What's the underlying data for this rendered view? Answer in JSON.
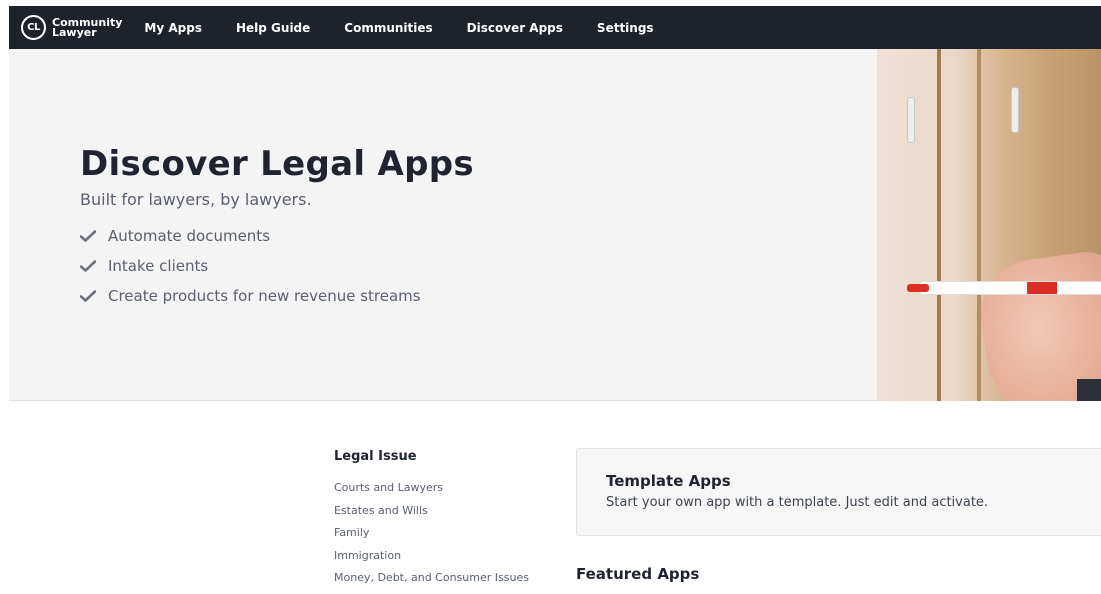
{
  "nav": {
    "logo": {
      "mark": "CL",
      "line1": "Community",
      "line2": "Lawyer"
    },
    "items": [
      "My Apps",
      "Help Guide",
      "Communities",
      "Discover Apps",
      "Settings"
    ]
  },
  "hero": {
    "title": "Discover Legal Apps",
    "subtitle": "Built for lawyers, by lawyers.",
    "features": [
      "Automate documents",
      "Intake clients",
      "Create products for new revenue streams"
    ]
  },
  "legal_issue": {
    "title": "Legal Issue",
    "items": [
      "Courts and Lawyers",
      "Estates and Wills",
      "Family",
      "Immigration",
      "Money, Debt, and Consumer Issues"
    ]
  },
  "template_apps": {
    "title": "Template Apps",
    "description": "Start your own app with a template. Just edit and activate."
  },
  "featured": {
    "title": "Featured Apps"
  },
  "colors": {
    "navbar": "#1e222b",
    "hero_bg": "#f4f4f4",
    "check": "#6b7280",
    "marker_red": "#d93025"
  },
  "icons": {
    "feature": "check-icon"
  }
}
